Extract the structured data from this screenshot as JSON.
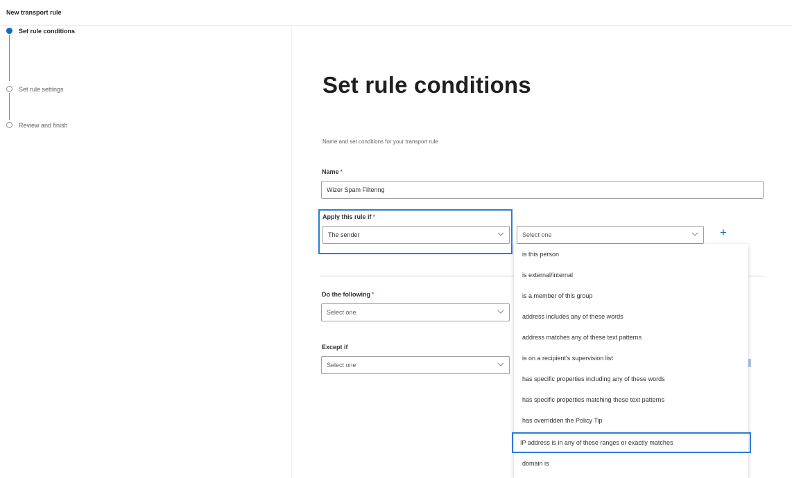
{
  "header": {
    "title": "New transport rule"
  },
  "steps": [
    {
      "label": "Set rule conditions",
      "state": "current"
    },
    {
      "label": "Set rule settings",
      "state": "upcoming"
    },
    {
      "label": "Review and finish",
      "state": "upcoming"
    }
  ],
  "main": {
    "title": "Set rule conditions",
    "subtitle": "Name and set conditions for your transport rule",
    "name_field": {
      "label": "Name",
      "required_mark": "*",
      "value": "Wizer Spam Filtering"
    },
    "apply_if": {
      "label": "Apply this rule if",
      "required_mark": "*",
      "primary_value": "The sender",
      "secondary_placeholder": "Select one",
      "add_label": "+"
    },
    "do_following": {
      "label": "Do the following",
      "required_mark": "*",
      "placeholder": "Select one"
    },
    "except_if": {
      "label": "Except if",
      "placeholder": "Select one"
    }
  },
  "menu": {
    "items": [
      "is this person",
      "is external/internal",
      "is a member of this group",
      "address includes any of these words",
      "address matches any of these text patterns",
      "is on a recipient's supervision list",
      "has specific properties including any of these words",
      "has specific properties matching these text patterns",
      "has overridden the Policy Tip",
      "IP address is in any of these ranges or exactly matches",
      "domain is"
    ],
    "selected_index": 9
  },
  "colors": {
    "accent": "#0f6cbd",
    "highlight_border": "#2b7cd3",
    "required": "#a4262c"
  },
  "icons": {
    "dropdown": "chevron-down-icon",
    "add": "plus-icon"
  }
}
